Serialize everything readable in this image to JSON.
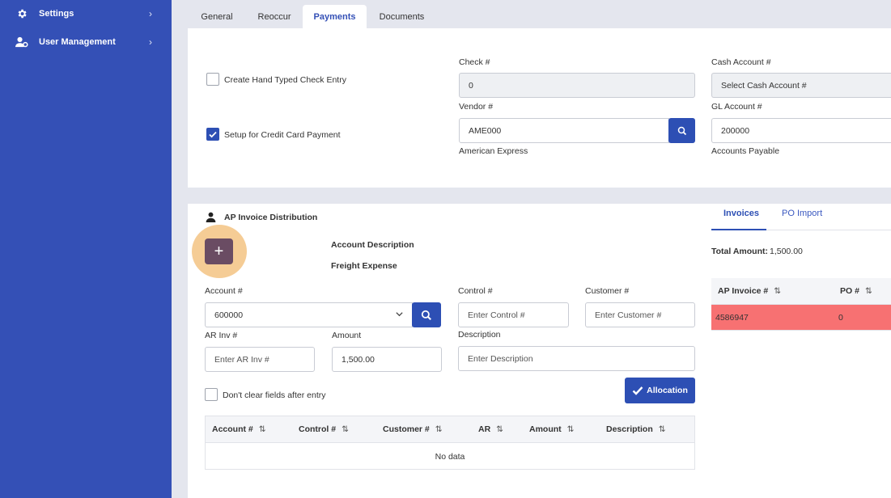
{
  "sidebar": {
    "items": [
      {
        "label": "Settings",
        "icon": "gear-icon"
      },
      {
        "label": "User Management",
        "icon": "user-gear-icon"
      }
    ]
  },
  "tabs": [
    {
      "label": "General",
      "active": false
    },
    {
      "label": "Reoccur",
      "active": false
    },
    {
      "label": "Payments",
      "active": true
    },
    {
      "label": "Documents",
      "active": false
    }
  ],
  "payments": {
    "hand_typed_label": "Create Hand Typed Check Entry",
    "hand_typed_checked": false,
    "credit_card_label": "Setup for Credit Card Payment",
    "credit_card_checked": true,
    "check_label": "Check #",
    "check_value": "0",
    "vendor_label": "Vendor #",
    "vendor_value": "AME000",
    "vendor_name": "American Express",
    "cash_account_label": "Cash Account #",
    "cash_account_placeholder": "Select Cash Account #",
    "gl_account_label": "GL Account #",
    "gl_account_value": "200000",
    "gl_account_name": "Accounts Payable"
  },
  "distribution": {
    "title": "AP Invoice Distribution",
    "add_button": "+",
    "account_desc_label": "Account Description",
    "account_desc_value": "Freight Expense",
    "account_label": "Account #",
    "account_value": "600000",
    "control_label": "Control #",
    "control_placeholder": "Enter Control #",
    "customer_label": "Customer #",
    "customer_placeholder": "Enter Customer #",
    "ar_inv_label": "AR Inv #",
    "ar_inv_placeholder": "Enter AR Inv #",
    "amount_label": "Amount",
    "amount_value": "1,500.00",
    "description_label": "Description",
    "description_placeholder": "Enter Description",
    "dont_clear_label": "Don't clear fields after entry",
    "allocation_button": "Allocation",
    "table": {
      "columns": [
        "Account #",
        "Control #",
        "Customer #",
        "AR",
        "Amount",
        "Description"
      ],
      "empty_text": "No data"
    }
  },
  "invoices_panel": {
    "tabs": [
      {
        "label": "Invoices",
        "active": true
      },
      {
        "label": "PO Import",
        "active": false
      }
    ],
    "total_label": "Total Amount:",
    "total_value": "1,500.00",
    "columns": [
      "AP Invoice #",
      "PO #"
    ],
    "rows": [
      {
        "invoice": "4586947",
        "po": "0"
      }
    ],
    "highlight_color": "#f77172"
  },
  "colors": {
    "sidebar": "#3450b6",
    "accent": "#2d4fb4",
    "add_button": "#6a4c63"
  },
  "sort_icon": "⇅"
}
